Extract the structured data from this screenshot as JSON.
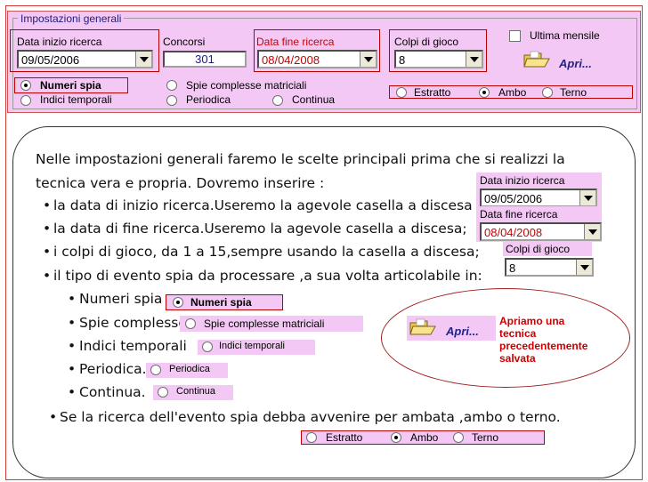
{
  "top": {
    "legend": "Impostazioni generali",
    "data_inizio": {
      "label": "Data inizio ricerca",
      "value": "09/05/2006"
    },
    "concorsi": {
      "label": "Concorsi",
      "value": "301"
    },
    "data_fine": {
      "label": "Data fine ricerca",
      "value": "08/04/2008"
    },
    "colpi": {
      "label": "Colpi di gioco",
      "value": "8"
    },
    "ultima_mensile": "Ultima mensile",
    "apri": "Apri...",
    "opts": {
      "numeri_spia": "Numeri spia",
      "indici_temporali": "Indici temporali",
      "spie_complesse": "Spie complesse matriciali",
      "periodica": "Periodica",
      "continua": "Continua"
    },
    "sorte": {
      "estratto": "Estratto",
      "ambo": "Ambo",
      "terno": "Terno"
    }
  },
  "guide": {
    "line1": "Nelle impostazioni generali faremo le scelte principali prima che si realizzi la",
    "line2": "tecnica vera e propria. Dovremo inserire :",
    "b1": "la data di inizio ricerca.Useremo la agevole casella a discesa",
    "b2": "la data di fine ricerca.Useremo la agevole casella a discesa;",
    "b3": "i colpi di gioco, da 1 a 15,sempre usando la casella a discesa;",
    "b4": "il tipo di evento spia da processare ,a sua volta articolabile in:",
    "s1": "Numeri spia",
    "s2": "Spie complesse",
    "s3": "Indici temporali",
    "s4": "Periodica.",
    "s5": "Continua.",
    "last": "Se la ricerca dell'evento spia debba avvenire per ambata ,ambo o terno.",
    "note": [
      "Apriamo una",
      "tecnica",
      "precedentemente",
      "salvata"
    ]
  }
}
